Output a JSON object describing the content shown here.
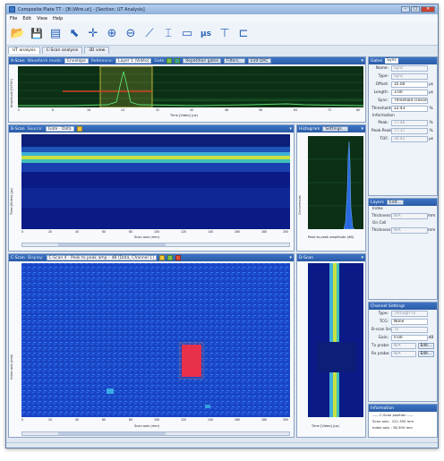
{
  "window": {
    "title": "Composite Plate TT - [B:\\Wire.ut] - [Section: UT Analysis]",
    "controls": [
      "–",
      "□",
      "✕"
    ]
  },
  "menu": [
    "File",
    "Edit",
    "View",
    "Help"
  ],
  "toolbar": {
    "tools": [
      {
        "icon": "folder-open-icon",
        "glyph": "📂"
      },
      {
        "icon": "save-icon",
        "glyph": "💾"
      },
      {
        "icon": "layout-icon",
        "glyph": "▤"
      },
      {
        "icon": "pointer-icon",
        "glyph": "⬉"
      },
      {
        "icon": "crosshair-icon",
        "glyph": "✛"
      },
      {
        "icon": "zoom-in-icon",
        "glyph": "⊕"
      },
      {
        "icon": "zoom-out-icon",
        "glyph": "⊖"
      },
      {
        "icon": "measure-icon",
        "glyph": "⟋"
      },
      {
        "icon": "gate-icon",
        "glyph": "⌶"
      },
      {
        "icon": "display-icon",
        "glyph": "▭"
      },
      {
        "icon": "microseconds-icon",
        "glyph": "μs"
      },
      {
        "icon": "probe-icon",
        "glyph": "⊤"
      },
      {
        "icon": "dac-icon",
        "glyph": "⊏"
      }
    ]
  },
  "tabs": [
    "UT analysis",
    "C-Scan analysis",
    "3D view"
  ],
  "ascan": {
    "title": "A-Scan",
    "waveform_mode_label": "Waveform mode:",
    "waveform_mode": "Envelope",
    "reference_label": "Reference:",
    "reference": "Layer 1 (Vidéo)",
    "gate_label": "Gate",
    "repetition_gates": "Repetition gates",
    "filters": "Filters...",
    "edit_dac": "Edit DAC",
    "xlabel": "Time [Video] (µs)",
    "ylabel": "Amplitude [%FSH]",
    "xticks": [
      "0",
      "4",
      "8",
      "12",
      "16",
      "20",
      "24",
      "28",
      "32",
      "36",
      "40",
      "44",
      "48",
      "52",
      "56",
      "60",
      "64",
      "68",
      "72",
      "76",
      "80"
    ],
    "yticks": [
      "100",
      "80",
      "60",
      "40",
      "20",
      "0"
    ]
  },
  "bscan": {
    "title": "B-Scan",
    "source_label": "Source:",
    "source": "Gate - Data",
    "xlabel": "Scan axis (mm)",
    "ylabel": "Time [Video] (µs)",
    "xticks": [
      "0",
      "10",
      "20",
      "30",
      "40",
      "50",
      "60",
      "70",
      "80",
      "90",
      "100",
      "110",
      "120",
      "130",
      "140",
      "150",
      "160",
      "170",
      "180",
      "190",
      "200"
    ]
  },
  "histogram": {
    "title": "Histogram",
    "settings": "Settings...",
    "xlabel": "Peak to peak amplitude (dB)",
    "ylabel": "Occurrences"
  },
  "cscan": {
    "title": "C-Scan",
    "display_label": "Display:",
    "display": "C-Scan 4 - Peak to peak amp – dB [Data, Channel 1]",
    "xlabel": "Scan axis (mm)",
    "ylabel": "Index axis (mm)",
    "xticks": [
      "0",
      "10",
      "20",
      "30",
      "40",
      "50",
      "60",
      "70",
      "80",
      "90",
      "100",
      "110",
      "120",
      "130",
      "140",
      "150",
      "160",
      "170",
      "180",
      "190",
      "200"
    ],
    "yticks": [
      "0",
      "10",
      "20",
      "30",
      "40",
      "50",
      "60",
      "70",
      "80",
      "90"
    ]
  },
  "dscan": {
    "title": "D-Scan",
    "xlabel": "Time [Video] (µs)"
  },
  "gates_panel": {
    "header": "Gates",
    "gate_select": "Sync",
    "name_label": "Name:",
    "name_value": "Sync",
    "type_label": "Type:",
    "type_value": "Sync",
    "offset_label": "Offset:",
    "offset_value": "35.00",
    "offset_unit": "µs",
    "length_label": "Length:",
    "length_value": "3.00",
    "length_unit": "µs",
    "sync_label": "Sync:",
    "sync_value": "Threshold crossing",
    "threshold_label": "Threshold:",
    "threshold_value": "22.43",
    "threshold_unit": "%",
    "information_label": "Information",
    "peak_label": "Peak:",
    "peak_value": "77.46",
    "peak_unit": "%",
    "peakpeak_label": "Peak-Peak:",
    "peakpeak_value": "77.37",
    "peakpeak_unit": "%",
    "tof_label": "TOF:",
    "tof_value": "36.42",
    "tof_unit": "µs"
  },
  "layers_panel": {
    "header": "Layers",
    "button": "Edit...",
    "index_label": "Index",
    "thickness_label": "Thickness:",
    "thickness_value": "N/A",
    "thickness_unit": "mm",
    "on_cell_label": "On Cell",
    "thickness2_label": "Thickness:",
    "thickness2_value": "N/A",
    "thickness2_unit": "mm"
  },
  "channel_panel": {
    "header": "Channel Settings",
    "type_label": "Type:",
    "type_value": "Through-Tx",
    "tcg_label": "TCG:",
    "tcg_value": "None",
    "probe_label": "B-scan Src:",
    "probe_value": "Tx",
    "gain_label": "Gain:",
    "gain_value": "0.00",
    "gain_unit": "dB",
    "tx_label": "Tx probe:",
    "tx_value": "N/A",
    "tx_button": "Edit...",
    "rx_label": "Rx probe:",
    "rx_value": "N/A",
    "rx_button": "Edit..."
  },
  "info_panel": {
    "header": "Information",
    "line1": "----- C-Scan position -----",
    "line2": "Scan axis : 121.350 mm",
    "line3": "Index axis : 38.300 mm"
  },
  "colors": {
    "accent": "#2a5ba7",
    "plot_background": "#0a1a70",
    "ascan_background": "#0b3015",
    "defect": "#e8304a"
  }
}
